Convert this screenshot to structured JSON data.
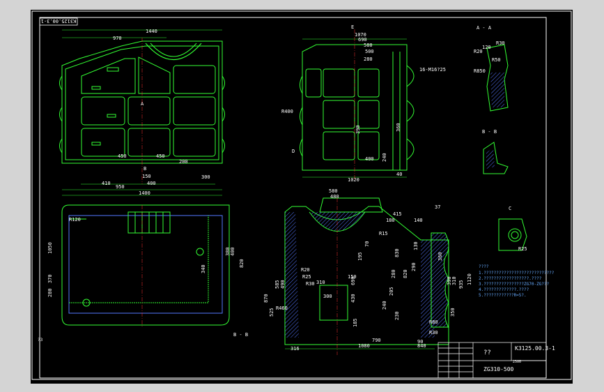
{
  "colors": {
    "background": "#000000",
    "frame": "#ffffff",
    "outline": "#33ff33",
    "dimension": "#ffffff",
    "centerline": "#ff3333",
    "hatch": "#5577ff",
    "note": "#4f8fff",
    "highlight": "#ffff33"
  },
  "drawing_code_rotated": "K3125.00.3-1",
  "title_block": {
    "name": "??",
    "code": "K3125.00.3-1",
    "material": "ZG310-500",
    "scale": "2500",
    "small_label": "?3"
  },
  "section_labels": {
    "aa": "A - A",
    "bb": "B - B",
    "cc": "C",
    "bottom": "B - B",
    "e": "E",
    "a": "A",
    "b": "B",
    "d": "D"
  },
  "notes": {
    "header": "????",
    "line1": "1.????????????????????????????",
    "line2": "2.??????????????????.????",
    "line3": "3.????????????????ZG70-ZG???",
    "line4": "4.?????????????.????",
    "line5": "5.????????????R=5?."
  },
  "dims": {
    "front_top": [
      "1440",
      "970"
    ],
    "front_mid": [
      "450",
      "450",
      "200"
    ],
    "front_bottom": [
      "410",
      "150",
      "400",
      "300"
    ],
    "front_total": [
      "950",
      "1400"
    ],
    "side_top": [
      "1070",
      "690",
      "580",
      "500",
      "280"
    ],
    "side_holes": "16-M16?25",
    "side_right": [
      "390",
      "360",
      "240",
      "400",
      "10",
      "10"
    ],
    "side_r": "R400",
    "side_bottom": [
      "1020",
      "40"
    ],
    "plan_left": [
      "1050",
      "370",
      "280"
    ],
    "plan_right": [
      "380",
      "400",
      "820",
      "340"
    ],
    "plan_r": "R120",
    "sec_top": [
      "580",
      "480",
      "415",
      "180",
      "140",
      "37"
    ],
    "sec_r": [
      "R15",
      "R20",
      "R25",
      "R30",
      "R460",
      "R80",
      "R30"
    ],
    "sec_left": [
      "870",
      "525",
      "585",
      "490"
    ],
    "sec_mid": [
      "195",
      "70",
      "150",
      "690",
      "310",
      "430",
      "300",
      "185"
    ],
    "sec_right": [
      "830",
      "820",
      "290",
      "280",
      "240",
      "205",
      "230",
      "130"
    ],
    "sec_far": [
      "1120",
      "935",
      "310",
      "360",
      "390",
      "350"
    ],
    "sec_bottom": [
      "1080",
      "790",
      "840",
      "316",
      "90"
    ],
    "aa_dims": [
      "120",
      "R30",
      "R20",
      "R50",
      "R850"
    ],
    "c_dims": [
      "R25"
    ]
  }
}
